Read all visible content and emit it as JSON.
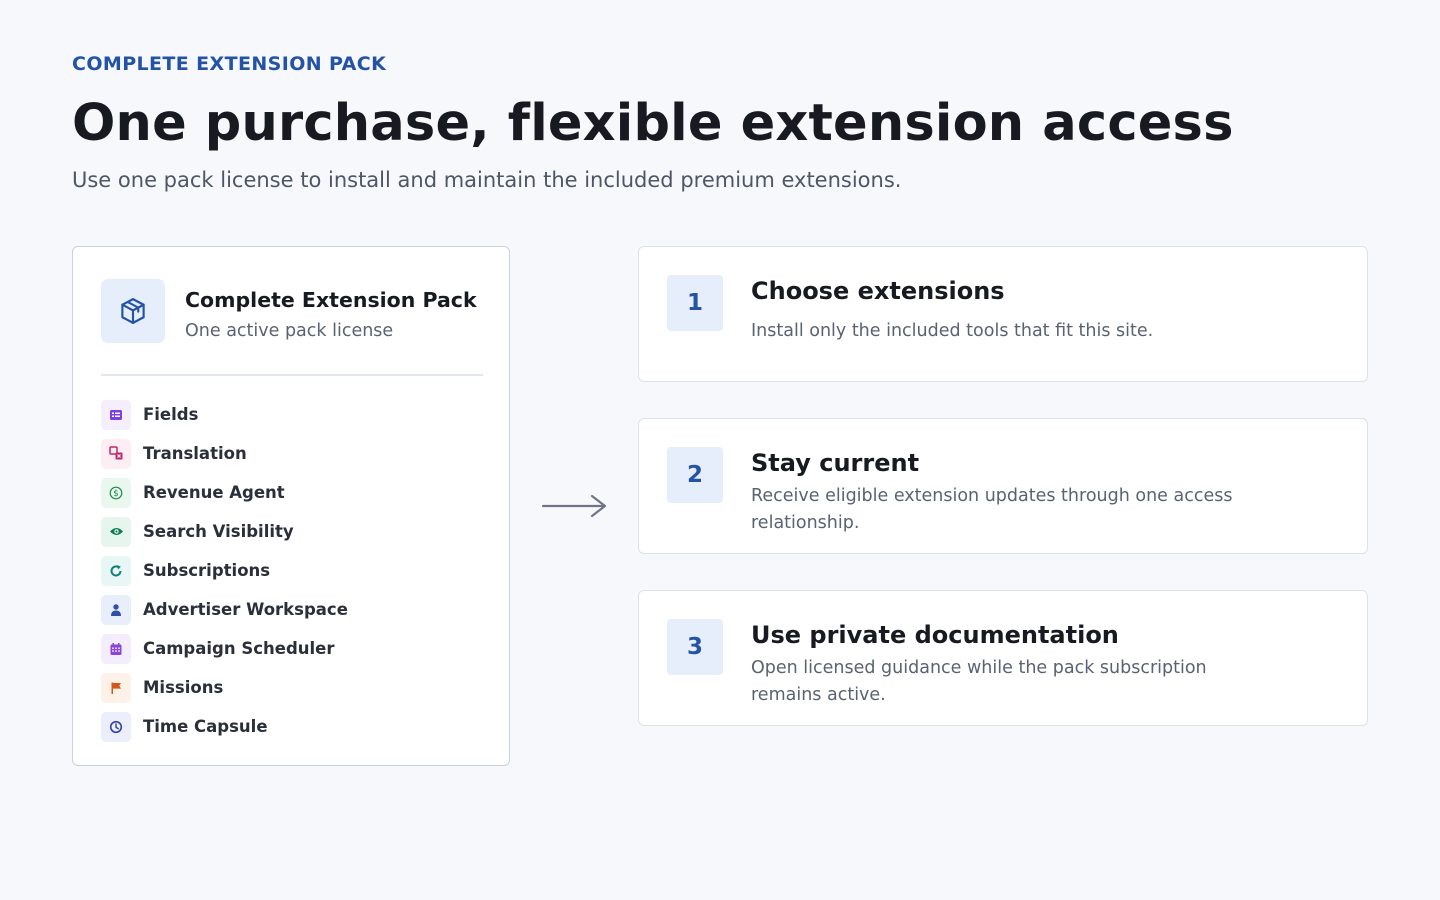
{
  "header": {
    "eyebrow": "COMPLETE EXTENSION PACK",
    "title": "One purchase, flexible extension access",
    "subtitle": "Use one pack license to install and maintain the included premium extensions."
  },
  "pack": {
    "icon": "package-icon",
    "title": "Complete Extension Pack",
    "subtitle": "One active pack license",
    "extensions": [
      {
        "label": "Fields",
        "icon": "form-fields-icon",
        "color": "#7b3fe4",
        "bg": "#f5effd"
      },
      {
        "label": "Translation",
        "icon": "translate-icon",
        "color": "#c2256b",
        "bg": "#fdeef4"
      },
      {
        "label": "Revenue Agent",
        "icon": "dollar-icon",
        "color": "#1e8a4c",
        "bg": "#eaf7ef"
      },
      {
        "label": "Search Visibility",
        "icon": "eye-icon",
        "color": "#0f7a57",
        "bg": "#e6f6ef"
      },
      {
        "label": "Subscriptions",
        "icon": "refresh-icon",
        "color": "#11807a",
        "bg": "#e8f7f5"
      },
      {
        "label": "Advertiser Workspace",
        "icon": "user-icon",
        "color": "#2f4fa8",
        "bg": "#e9eefb"
      },
      {
        "label": "Campaign Scheduler",
        "icon": "calendar-icon",
        "color": "#8a45d6",
        "bg": "#f3edfc"
      },
      {
        "label": "Missions",
        "icon": "flag-icon",
        "color": "#d4561a",
        "bg": "#fdf1e8"
      },
      {
        "label": "Time Capsule",
        "icon": "clock-icon",
        "color": "#35439a",
        "bg": "#eceefb"
      }
    ]
  },
  "flow_icon": "arrow-right-icon",
  "steps": [
    {
      "number": "1",
      "title": "Choose extensions",
      "body": "Install only the included tools that fit this site."
    },
    {
      "number": "2",
      "title": "Stay current",
      "body": "Receive eligible extension updates through one access relationship."
    },
    {
      "number": "3",
      "title": "Use private documentation",
      "body": "Open licensed guidance while the pack subscription remains active."
    }
  ],
  "colors": {
    "accent": "#2453a6",
    "background": "#f6f8fc",
    "card": "#ffffff",
    "text": "#171a21",
    "muted": "#5a6272"
  }
}
